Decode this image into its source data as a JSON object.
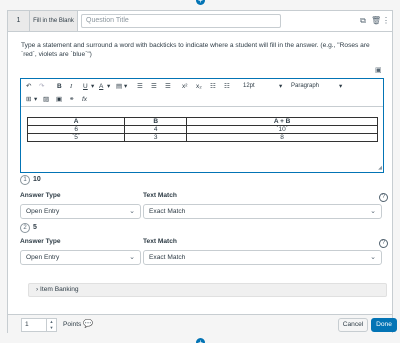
{
  "question": {
    "number": "1",
    "type": "Fill in the Blank",
    "title_placeholder": "Question Title",
    "instructions": "Type a statement and surround a word with backticks to indicate where a student will fill in the answer. (e.g., \"Roses are `red`, violets are `blue`\")"
  },
  "toolbar": {
    "font_size": "12pt",
    "block_format": "Paragraph"
  },
  "table": {
    "headers": [
      "A",
      "B",
      "A + B"
    ],
    "rows": [
      [
        "6",
        "4",
        "`10`"
      ],
      [
        "`5`",
        "3",
        "8"
      ]
    ]
  },
  "answers": [
    {
      "index": "1",
      "value": "10",
      "answer_type_label": "Answer Type",
      "answer_type_value": "Open Entry",
      "text_match_label": "Text Match",
      "text_match_value": "Exact Match"
    },
    {
      "index": "2",
      "value": "5",
      "answer_type_label": "Answer Type",
      "answer_type_value": "Open Entry",
      "text_match_label": "Text Match",
      "text_match_value": "Exact Match"
    }
  ],
  "item_banking": "Item Banking",
  "footer": {
    "points_value": "1",
    "points_label": "Points",
    "cancel_label": "Cancel",
    "done_label": "Done"
  },
  "colors": {
    "primary": "#0374b5",
    "border": "#c7cdd1",
    "text": "#2d3b45"
  }
}
